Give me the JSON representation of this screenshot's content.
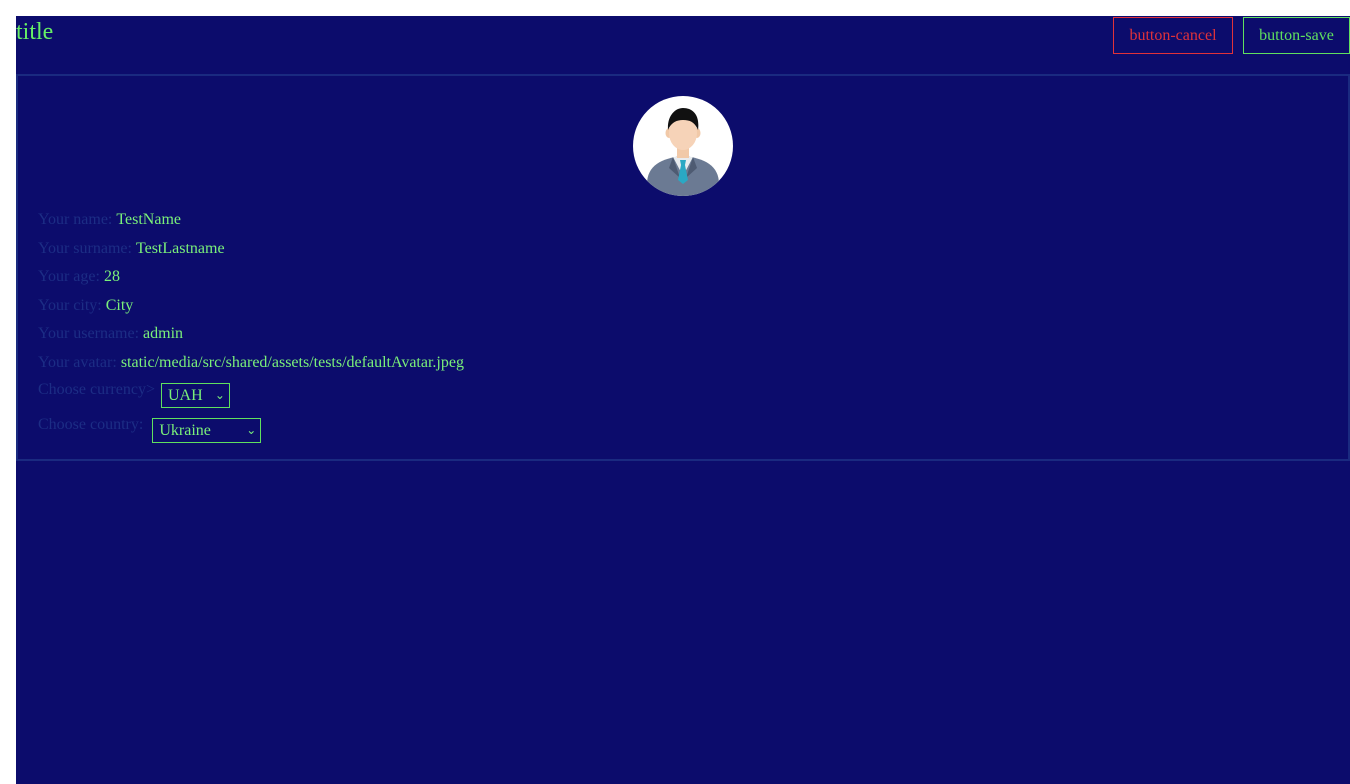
{
  "header": {
    "title": "title",
    "cancel_label": "button-cancel",
    "save_label": "button-save"
  },
  "colors": {
    "background": "#0c0c6c",
    "accent_green": "#5fe05f",
    "danger_red": "#e0323a",
    "label_muted": "#1c2d85"
  },
  "profile": {
    "avatar_icon": "default-avatar-icon",
    "fields": [
      {
        "label": "Your name:",
        "value": "TestName"
      },
      {
        "label": "Your surname:",
        "value": "TestLastname"
      },
      {
        "label": "Your age:",
        "value": "28"
      },
      {
        "label": "Your city:",
        "value": "City"
      },
      {
        "label": "Your username:",
        "value": "admin"
      },
      {
        "label": "Your avatar:",
        "value": "static/media/src/shared/assets/tests/defaultAvatar.jpeg"
      }
    ],
    "currency": {
      "label": "Choose currency>",
      "selected": "UAH"
    },
    "country": {
      "label": "Choose country:",
      "selected": "Ukraine"
    }
  }
}
